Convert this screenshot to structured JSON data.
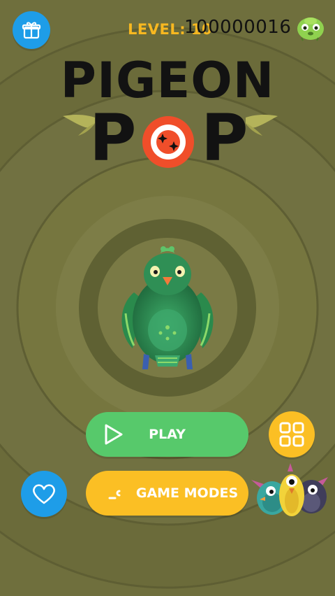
{
  "hud": {
    "level_label": "LEVEL: 10",
    "coins": "100000016",
    "gift_icon": "gift-icon",
    "avatar_icon": "green-bird-avatar-icon"
  },
  "logo": {
    "line1": "PIGEON",
    "line2_left": "P",
    "line2_right": "P",
    "target_icon": "target-icon",
    "wings_icon": "wings-icon"
  },
  "character": {
    "icon": "green-pigeon-icon"
  },
  "menu": {
    "play_label": "PLAY",
    "modes_label": "GAME MODES",
    "play_icon": "play-icon",
    "modes_icon": "game-modes-icon",
    "grid_icon": "grid-icon",
    "heart_icon": "heart-icon",
    "birds_icon": "birds-group-icon"
  },
  "colors": {
    "background": "#6f6f3d",
    "ring_dark": "#5f6133",
    "ring_light": "#7a7a45",
    "play_green": "#57c96b",
    "modes_yellow": "#fbbf24",
    "grid_yellow": "#fbbf24",
    "heart_blue": "#1e9de8",
    "gift_blue": "#1e9de8",
    "level_yellow": "#f8b820",
    "target_red": "#f04e2a"
  }
}
